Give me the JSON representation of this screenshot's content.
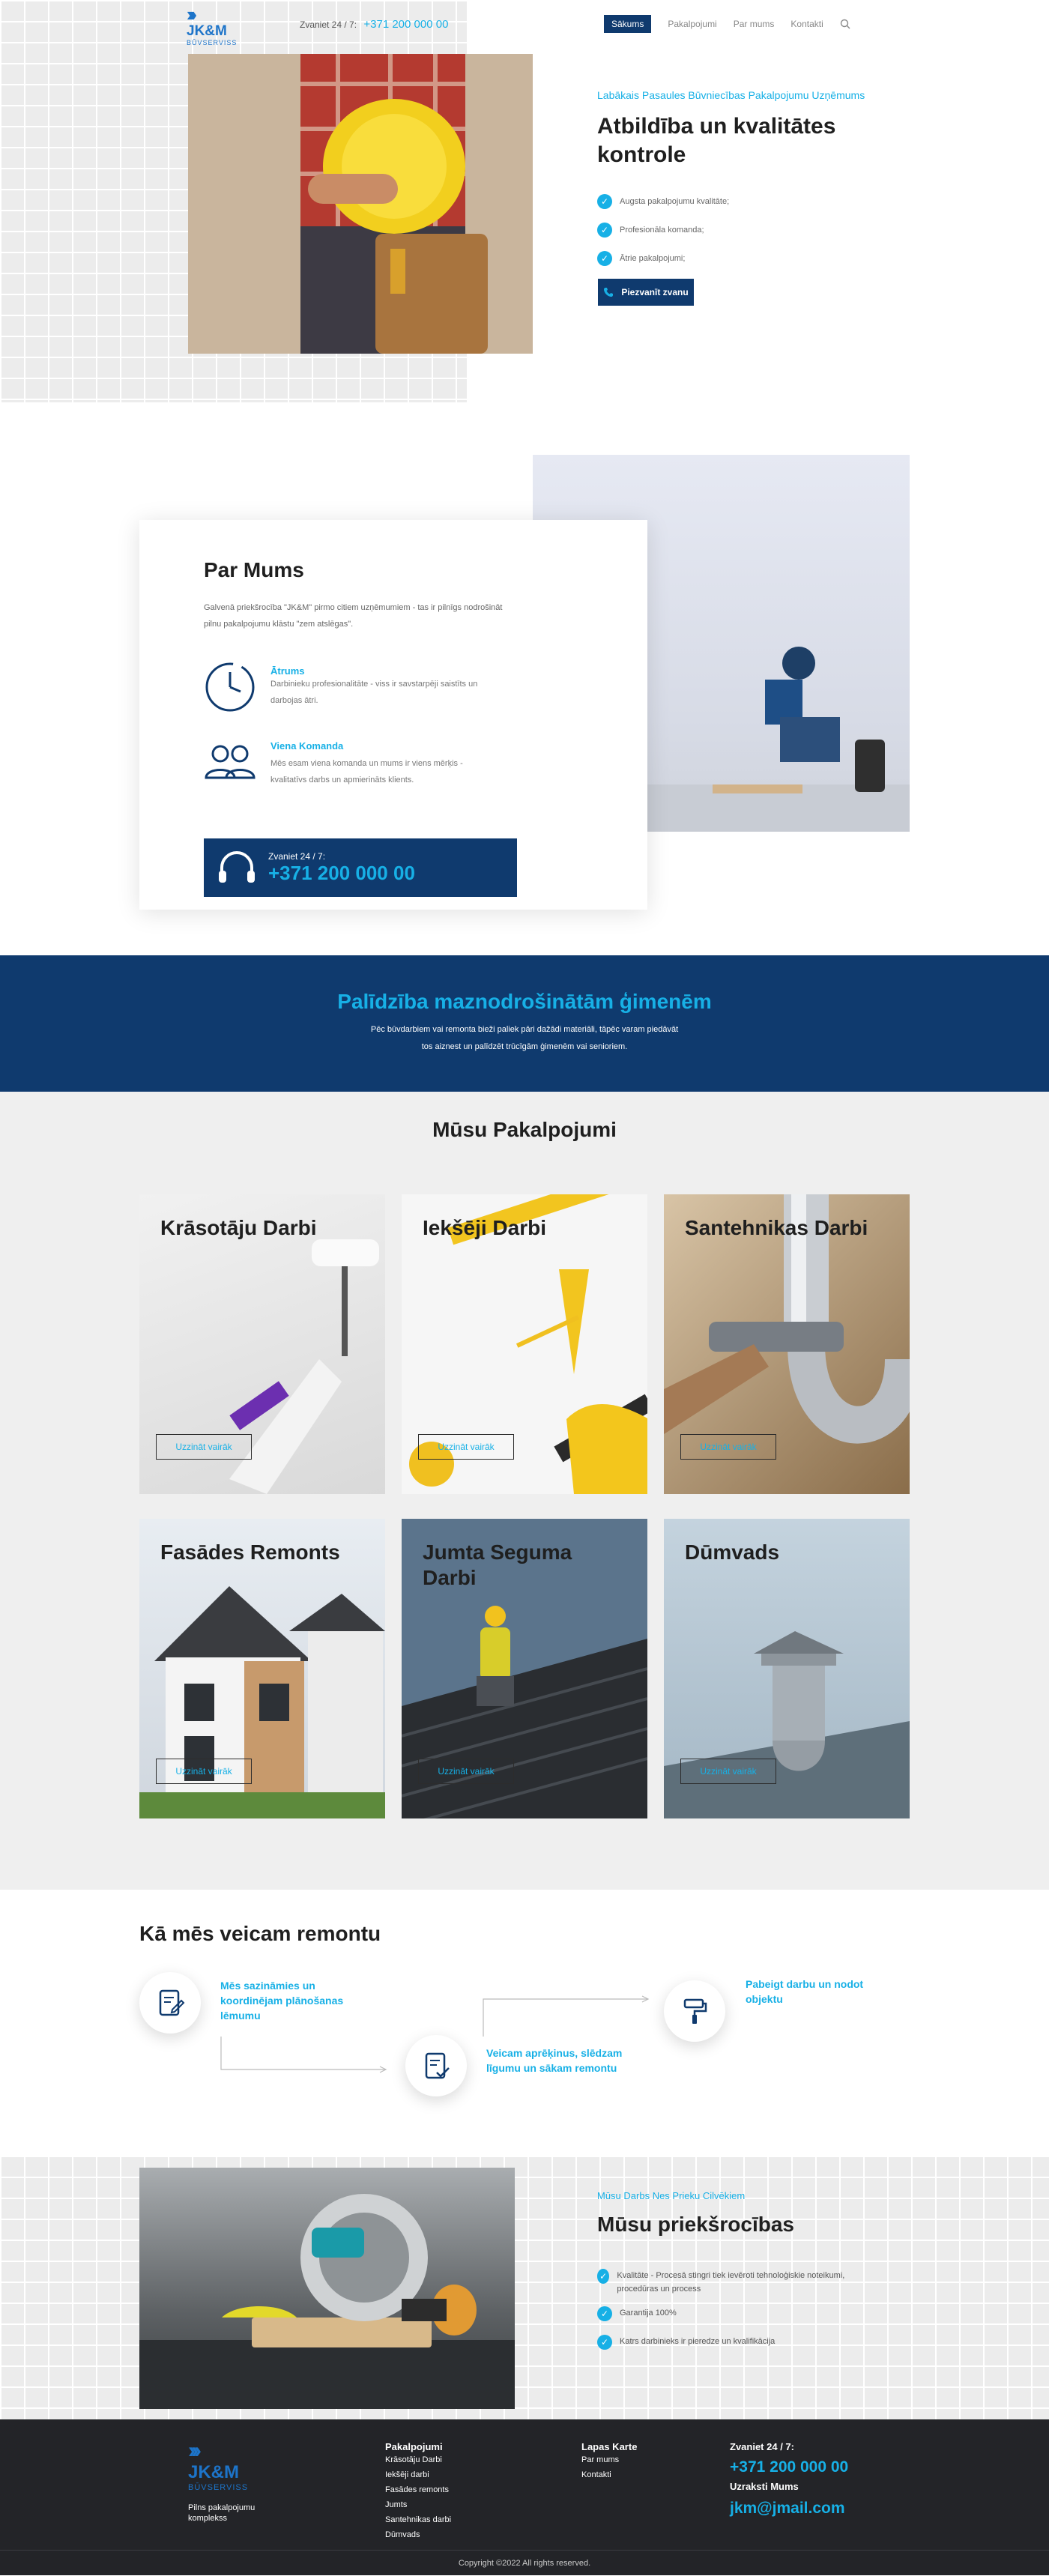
{
  "header": {
    "logo_name": "JK&M",
    "logo_sub": "BŪVSERVISS",
    "phone_label": "Zvaniet 24 / 7:",
    "phone_number": "+371  200 000 00",
    "nav": [
      "Sākums",
      "Pakalpojumi",
      "Par mums",
      "Kontakti"
    ],
    "search_icon": "search-icon"
  },
  "hero": {
    "subtitle": "Labākais Pasaules Būvniecības Pakalpojumu Uzņēmums",
    "title": "Atbildība un kvalitātes kontrole",
    "checks": [
      "Augsta pakalpojumu kvalitāte;",
      "Profesionāla komanda;",
      "Ātrie pakalpojumi;"
    ],
    "button": "Piezvanīt zvanu"
  },
  "about": {
    "title": "Par Mums",
    "text": "Galvenā priekšrocība \"JK&M\" pirmo citiem uzņēmumiem - tas ir pilnīgs nodrošināt pilnu pakalpojumu klāstu \"zem atslēgas\".",
    "features": [
      {
        "title": "Ātrums",
        "text": "Darbinieku profesionalitāte - viss ir savstarpēji saistīts un darbojas ātri.",
        "icon": "clock-icon"
      },
      {
        "title": "Viena Komanda",
        "text": "Mēs esam viena komanda un mums ir viens mērķis - kvalitatīvs darbs un apmierināts klients.",
        "icon": "team-icon"
      }
    ],
    "call_label": "Zvaniet 24 / 7:",
    "call_number": "+371  200 000 00"
  },
  "banner": {
    "title": "Palīdzība maznodrošinātām ģimenēm",
    "line1": "Pēc būvdarbiem vai remonta bieži paliek pāri dažādi materiāli, tāpēc varam piedāvāt",
    "line2": "tos aiznest un palīdzēt trūcīgām ģimenēm vai senioriem."
  },
  "services": {
    "title": "Mūsu Pakalpojumi",
    "button_label": "Uzzināt vairāk",
    "cards": [
      {
        "title": "Krāsotāju Darbi"
      },
      {
        "title": "Iekšēji Darbi"
      },
      {
        "title": "Santehnikas Darbi"
      },
      {
        "title": "Fasādes Remonts"
      },
      {
        "title": "Jumta Seguma Darbi"
      },
      {
        "title": "Dūmvads"
      }
    ]
  },
  "process": {
    "title": "Kā mēs veicam remontu",
    "steps": [
      {
        "text": "Mēs sazināmies un koordinējam plānošanas lēmumu",
        "icon": "document-edit-icon"
      },
      {
        "text": "Veicam aprēķinus, slēdzam līgumu un sākam remontu",
        "icon": "document-check-icon"
      },
      {
        "text": "Pabeigt darbu un nodot objektu",
        "icon": "paint-roller-icon"
      }
    ]
  },
  "advantages": {
    "subtitle": "Mūsu Darbs Nes Prieku Cilvēkiem",
    "title": "Mūsu priekšrocības",
    "items": [
      "Kvalitāte - Procesā stingri tiek ievēroti tehnoloģiskie noteikumi, procedūras un process",
      "Garantija 100%",
      "Katrs darbinieks ir pieredze un kvalifikācija"
    ]
  },
  "footer": {
    "logo_name": "JK&M",
    "logo_sub": "BŪVSERVISS",
    "tagline": "Pilns pakalpojumu komplekss",
    "services_title": "Pakalpojumi",
    "services_links": [
      "Krāsotāju Darbi",
      "Iekšēji darbi",
      "Fasādes remonts",
      "Jumts",
      "Santehnikas darbi",
      "Dūmvads"
    ],
    "map_title": "Lapas Karte",
    "map_links": [
      "Par mums",
      "Kontakti"
    ],
    "call_label": "Zvaniet 24 / 7:",
    "call_number": "+371  200 000 00",
    "write_label": "Uzraksti Mums",
    "email": "jkm@jmail.com",
    "copyright": "Copyright ©2022 All rights reserved."
  },
  "colors": {
    "accent": "#17b0e6",
    "navy": "#0f3a6e",
    "footer": "#232428"
  }
}
